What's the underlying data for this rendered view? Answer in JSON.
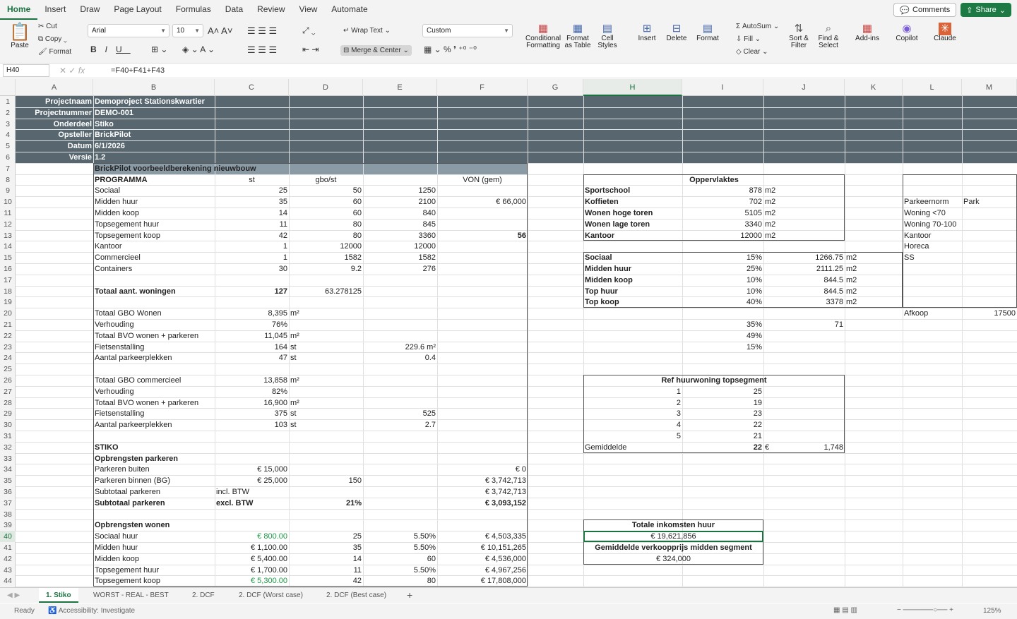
{
  "ribbon_tabs": [
    "Home",
    "Insert",
    "Draw",
    "Page Layout",
    "Formulas",
    "Data",
    "Review",
    "View",
    "Automate"
  ],
  "comments_label": "Comments",
  "share_label": "Share",
  "ribbon": {
    "paste": "Paste",
    "cut": "Cut",
    "copy": "Copy",
    "format": "Format",
    "font": "Arial",
    "size": "10",
    "wrap": "Wrap Text",
    "merge": "Merge & Center",
    "numfmt": "Custom",
    "cond": "Conditional Formatting",
    "fmt_table": "Format as Table",
    "cell_styles": "Cell Styles",
    "insert": "Insert",
    "delete": "Delete",
    "format2": "Format",
    "autosum": "AutoSum",
    "fill": "Fill",
    "clear": "Clear",
    "sort": "Sort & Filter",
    "find": "Find & Select",
    "addins": "Add-ins",
    "copilot": "Copilot",
    "claude": "Claude"
  },
  "formula_bar": {
    "name": "H40",
    "formula": "=F40+F41+F43"
  },
  "columns": [
    "A",
    "B",
    "C",
    "D",
    "E",
    "F",
    "G",
    "H",
    "I",
    "J",
    "K",
    "L",
    "M"
  ],
  "header_block": [
    [
      "Projectnaam",
      "Demoproject Stationskwartier"
    ],
    [
      "Projectnummer",
      "DEMO-001"
    ],
    [
      "Onderdeel",
      "Stiko"
    ],
    [
      "Opsteller",
      "BrickPilot"
    ],
    [
      "Datum",
      "6/1/2026"
    ],
    [
      "Versie",
      "1.2"
    ]
  ],
  "title7": "BrickPilot voorbeeldberekening nieuwbouw",
  "programma": {
    "label": "PROGRAMMA",
    "st": "st",
    "gbo": "gbo/st",
    "von": "VON (gem)"
  },
  "rows": [
    [
      "Sociaal",
      "25",
      "50",
      "1250",
      ""
    ],
    [
      "Midden huur",
      "35",
      "60",
      "2100",
      "€ 66,000"
    ],
    [
      "Midden koop",
      "14",
      "60",
      "840",
      ""
    ],
    [
      "Topsegement huur",
      "11",
      "80",
      "845",
      ""
    ],
    [
      "Topsegement koop",
      "42",
      "80",
      "3360",
      "56"
    ],
    [
      "Kantoor",
      "1",
      "12000",
      "12000",
      ""
    ],
    [
      "Commercieel",
      "1",
      "1582",
      "1582",
      ""
    ],
    [
      "Containers",
      "30",
      "9.2",
      "276",
      ""
    ]
  ],
  "totaal_woningen": [
    "Totaal aant. woningen",
    "127",
    "63.278125"
  ],
  "block20": [
    [
      "Totaal GBO Wonen",
      "8,395",
      "m²",
      ""
    ],
    [
      "Verhouding",
      "76%",
      "",
      ""
    ],
    [
      "Totaal BVO wonen + parkeren",
      "11,045",
      "m²",
      ""
    ],
    [
      "Fietsenstalling",
      "164",
      "st",
      "229.6 m²"
    ],
    [
      "Aantal parkeerplekken",
      "47",
      "st",
      "0.4"
    ]
  ],
  "block26": [
    [
      "Totaal GBO commercieel",
      "13,858",
      "m²",
      ""
    ],
    [
      "Verhouding",
      "82%",
      "",
      ""
    ],
    [
      "Totaal BVO wonen + parkeren",
      "16,900",
      "m²",
      ""
    ],
    [
      "Fietsenstalling",
      "375",
      "st",
      "525"
    ],
    [
      "Aantal parkeerplekken",
      "103",
      "st",
      "2.7"
    ]
  ],
  "stiko": "STIKO",
  "opbr_park": "Opbrengsten parkeren",
  "park": [
    [
      "Parkeren buiten",
      "€ 15,000",
      "",
      "€ 0"
    ],
    [
      "Parkeren binnen (BG)",
      "€ 25,000",
      "150",
      "€ 3,742,713"
    ],
    [
      "Subtotaal parkeren",
      "incl. BTW",
      "",
      "€ 3,742,713"
    ],
    [
      "Subtotaal parkeren",
      "excl. BTW",
      "21%",
      "€ 3,093,152"
    ]
  ],
  "opbr_won": "Opbrengsten wonen",
  "won": [
    [
      "Sociaal huur",
      "€ 800.00",
      "25",
      "5.50%",
      "€ 4,503,335"
    ],
    [
      "Midden huur",
      "€ 1,100.00",
      "35",
      "5.50%",
      "€ 10,151,265"
    ],
    [
      "Midden koop",
      "€ 5,400.00",
      "14",
      "60",
      "€ 4,536,000"
    ],
    [
      "Topsegement huur",
      "€ 1,700.00",
      "11",
      "5.50%",
      "€ 4,967,256"
    ],
    [
      "Topsegement koop",
      "€ 5,300.00",
      "42",
      "80",
      "€ 17,808,000"
    ]
  ],
  "opp_title": "Oppervlaktes",
  "opp": [
    [
      "Sportschool",
      "878",
      "m2"
    ],
    [
      "Koffieten",
      "702",
      "m2"
    ],
    [
      "Wonen hoge toren",
      "5105",
      "m2"
    ],
    [
      "Wonen lage toren",
      "3340",
      "m2"
    ],
    [
      "Kantoor",
      "12000",
      "m2"
    ]
  ],
  "seg": [
    [
      "Sociaal",
      "15%",
      "1266.75",
      "m2"
    ],
    [
      "Midden huur",
      "25%",
      "2111.25",
      "m2"
    ],
    [
      "Midden koop",
      "10%",
      "844.5",
      "m2"
    ],
    [
      "Top huur",
      "10%",
      "844.5",
      "m2"
    ],
    [
      "Top koop",
      "40%",
      "3378",
      "m2"
    ]
  ],
  "pct": [
    [
      "35%",
      "71"
    ],
    [
      "49%",
      ""
    ],
    [
      "15%",
      ""
    ]
  ],
  "ref_title": "Ref huurwoning topsegment",
  "ref": [
    [
      "1",
      "25"
    ],
    [
      "2",
      "19"
    ],
    [
      "3",
      "23"
    ],
    [
      "4",
      "22"
    ],
    [
      "5",
      "21"
    ]
  ],
  "gem": [
    "Gemiddelde",
    "22",
    "€",
    "1,748"
  ],
  "tot_huur_title": "Totale inkomsten huur",
  "tot_huur": "€ 19,621,856",
  "gem_vk_title": "Gemiddelde verkoopprijs midden segment",
  "gem_vk": "€ 324,000",
  "park_norm": [
    [
      "Parkeernorm",
      "Park"
    ],
    [
      "Woning <70",
      ""
    ],
    [
      "Woning 70-100",
      ""
    ],
    [
      "Kantoor",
      ""
    ],
    [
      "Horeca",
      ""
    ],
    [
      "SS",
      ""
    ]
  ],
  "afkoop": [
    "Afkoop",
    "17500"
  ],
  "sheets": [
    "1. Stiko",
    "WORST - REAL - BEST",
    "2. DCF",
    "2. DCF (Worst case)",
    "2. DCF (Best case)"
  ],
  "status": {
    "ready": "Ready",
    "access": "Accessibility: Investigate",
    "zoom": "125%"
  }
}
